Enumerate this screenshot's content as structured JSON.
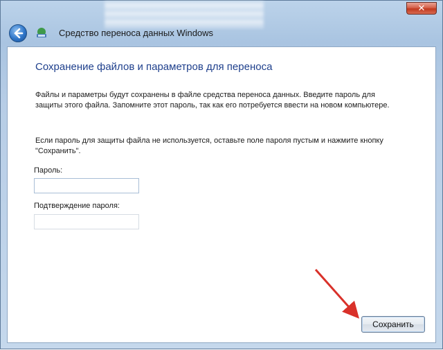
{
  "window": {
    "app_title": "Средство переноса данных Windows",
    "close_glyph": "✕"
  },
  "content": {
    "heading": "Сохранение файлов и параметров для переноса",
    "paragraph1": "Файлы и параметры будут сохранены в файле средства переноса данных. Введите пароль для защиты этого файла. Запомните этот пароль, так как его потребуется ввести на новом компьютере.",
    "paragraph2": "Если пароль для защиты файла не используется, оставьте поле пароля пустым и нажмите кнопку \"Сохранить\".",
    "password_label": "Пароль:",
    "password_value": "",
    "confirm_label": "Подтверждение пароля:",
    "confirm_value": ""
  },
  "buttons": {
    "save_label": "Сохранить"
  },
  "annotation": {
    "arrow_color": "#d9312a"
  },
  "icons": {
    "back": "back-arrow-icon",
    "app": "transfer-app-icon",
    "close": "close-icon"
  }
}
